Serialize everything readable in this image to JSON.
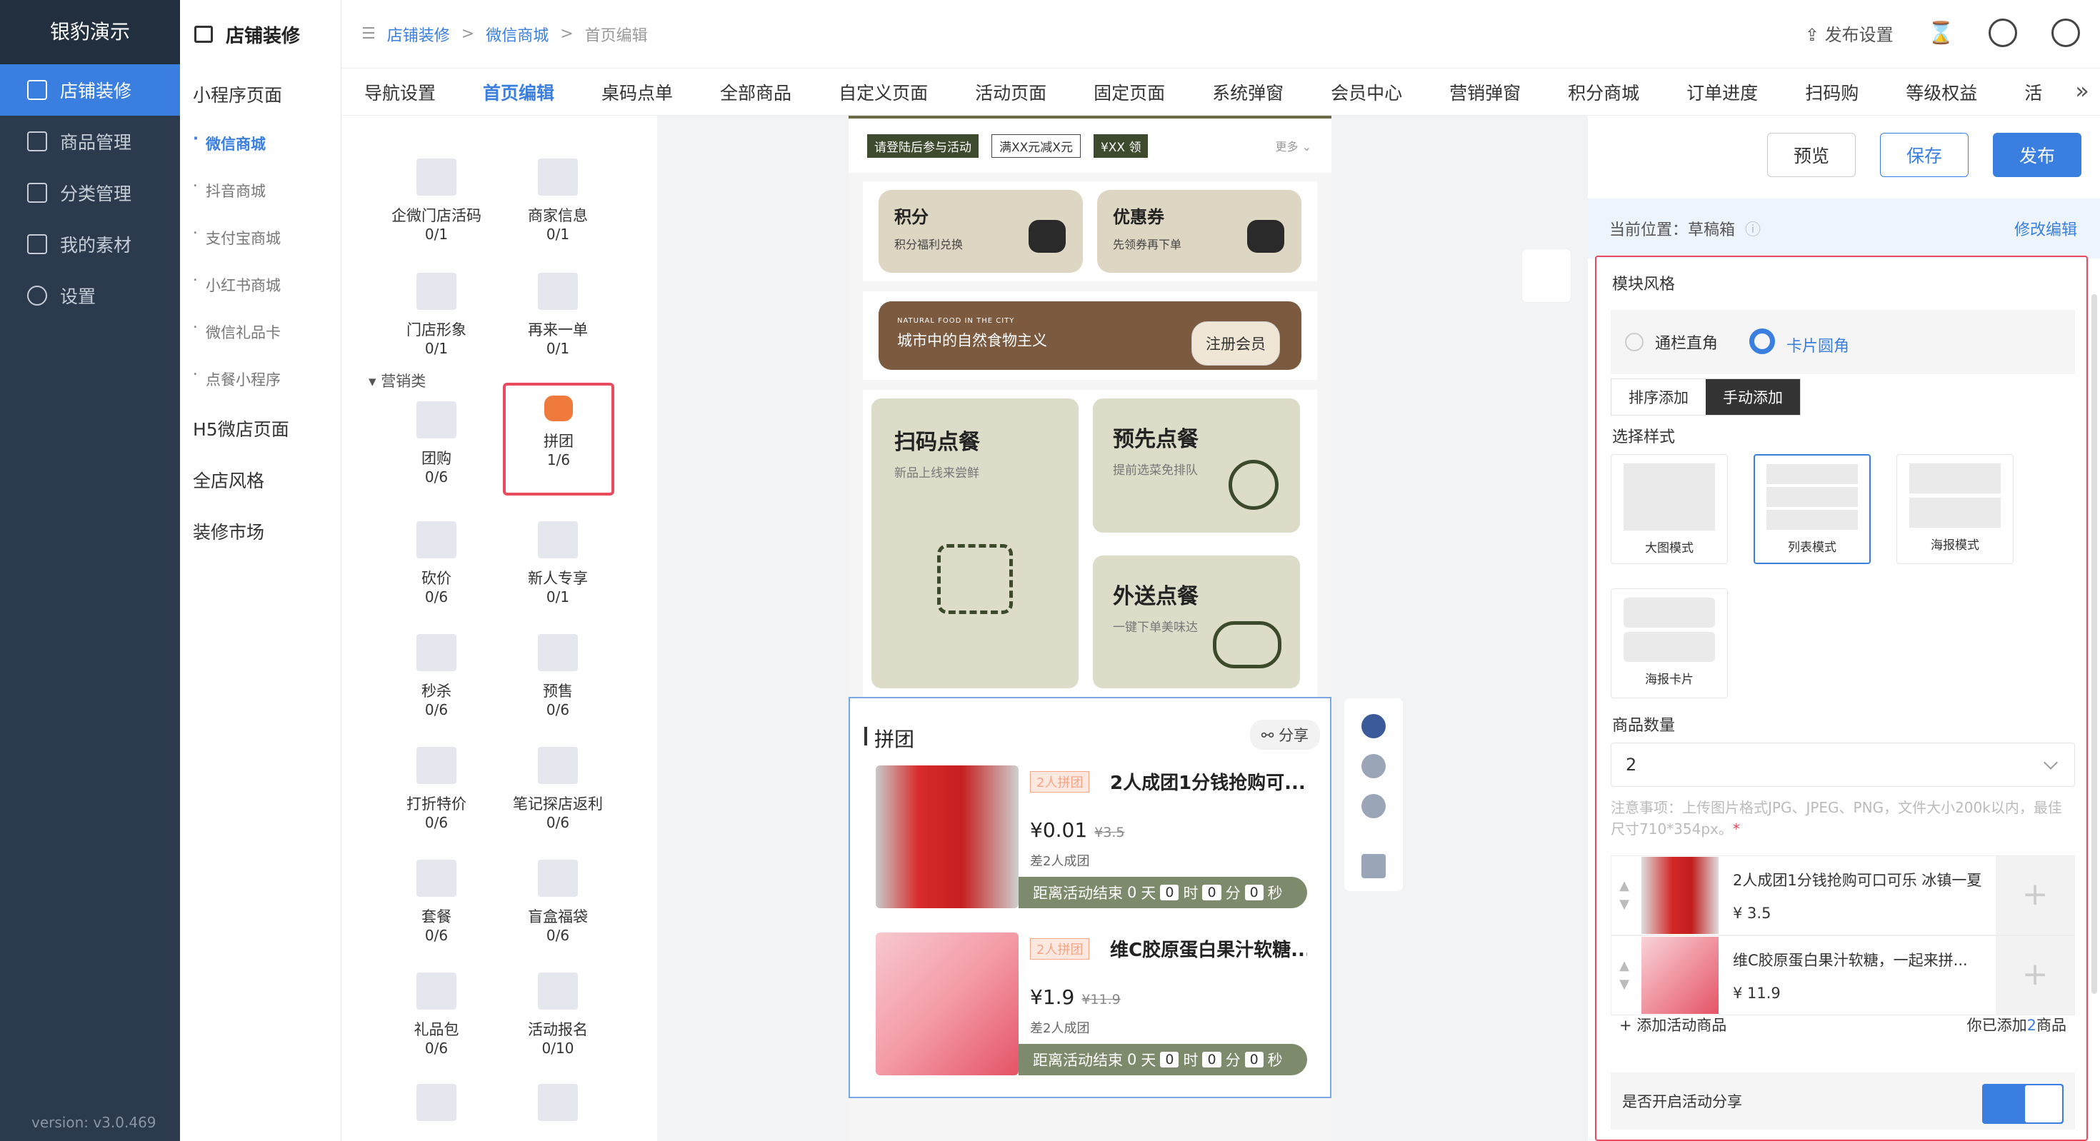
{
  "app": {
    "brand": "银豹演示",
    "version": "version: v3.0.469"
  },
  "nav1": [
    {
      "label": "店铺装修",
      "active": true
    },
    {
      "label": "商品管理"
    },
    {
      "label": "分类管理"
    },
    {
      "label": "我的素材"
    },
    {
      "label": "设置"
    }
  ],
  "nav2": {
    "title": "店铺装修",
    "group1": "小程序页面",
    "subs": [
      "微信商城",
      "抖音商城",
      "支付宝商城",
      "小红书商城",
      "微信礼品卡",
      "点餐小程序"
    ],
    "groups": [
      "H5微店页面",
      "全店风格",
      "装修市场"
    ]
  },
  "breadcrumb": {
    "a": "店铺装修",
    "sep": ">",
    "b": "微信商城",
    "c": "首页编辑"
  },
  "topbar": {
    "publish_settings": "发布设置"
  },
  "tabs": [
    "导航设置",
    "首页编辑",
    "桌码点单",
    "全部商品",
    "自定义页面",
    "活动页面",
    "固定页面",
    "系统弹窗",
    "会员中心",
    "营销弹窗",
    "积分商城",
    "订单进度",
    "扫码购",
    "等级权益",
    "活"
  ],
  "components": [
    {
      "name": "企微门店活码",
      "count": "0/1"
    },
    {
      "name": "商家信息",
      "count": "0/1"
    },
    {
      "name": "门店形象",
      "count": "0/1"
    },
    {
      "name": "再来一单",
      "count": "0/1"
    },
    {
      "name": "团购",
      "count": "0/6"
    },
    {
      "name": "拼团",
      "count": "1/6"
    },
    {
      "name": "砍价",
      "count": "0/6"
    },
    {
      "name": "新人专享",
      "count": "0/1"
    },
    {
      "name": "秒杀",
      "count": "0/6"
    },
    {
      "name": "预售",
      "count": "0/6"
    },
    {
      "name": "打折特价",
      "count": "0/6"
    },
    {
      "name": "笔记探店返利",
      "count": "0/6"
    },
    {
      "name": "套餐",
      "count": "0/6"
    },
    {
      "name": "盲盒福袋",
      "count": "0/6"
    },
    {
      "name": "礼品包",
      "count": "0/6"
    },
    {
      "name": "活动报名",
      "count": "0/10"
    }
  ],
  "category": "营销类",
  "preview": {
    "coupon": {
      "t1": "请登陆后参与活动",
      "t2": "满XX元减X元",
      "t3": "¥XX",
      "t4": "领",
      "more": "更多 ⌄"
    },
    "card1": {
      "title": "积分",
      "sub": "积分福利兑换"
    },
    "card2": {
      "title": "优惠券",
      "sub": "先领券再下单"
    },
    "banner": {
      "en": "NATURAL FOOD IN THE CITY",
      "cn": "城市中的自然食物主义",
      "btn": "注册会员"
    },
    "food": [
      {
        "title": "扫码点餐",
        "sub": "新品上线来尝鲜"
      },
      {
        "title": "预先点餐",
        "sub": "提前选菜免排队"
      },
      {
        "title": "外送点餐",
        "sub": "一键下单美味达"
      }
    ],
    "group": {
      "title": "拼团",
      "share": "分享",
      "products": [
        {
          "badge": "2人拼团",
          "name": "2人成团1分钱抢购可...",
          "price": "¥0.01",
          "orig": "¥3.5",
          "diff": "差2人成团",
          "cd": [
            "距离活动结束",
            "0",
            "天",
            "0",
            "时",
            "0",
            "分",
            "0",
            "秒"
          ]
        },
        {
          "badge": "2人拼团",
          "name": "维C胶原蛋白果汁软糖...",
          "price": "¥1.9",
          "orig": "¥11.9",
          "diff": "差2人成团",
          "cd": [
            "距离活动结束",
            "0",
            "天",
            "0",
            "时",
            "0",
            "分",
            "0",
            "秒"
          ]
        }
      ]
    }
  },
  "panel": {
    "preview": "预览",
    "save": "保存",
    "publish": "发布",
    "location": "当前位置：草稿箱",
    "edit": "修改编辑",
    "module_style": "模块风格",
    "r1": "通栏直角",
    "r2": "卡片圆角",
    "seg1": "排序添加",
    "seg2": "手动添加",
    "choose": "选择样式",
    "styles": [
      "大图模式",
      "列表模式",
      "海报模式",
      "海报卡片"
    ],
    "qty_label": "商品数量",
    "qty": "2",
    "note": "注意事项：上传图片格式JPG、JPEG、PNG，文件大小200k以内，最佳尺寸710*354px。",
    "items": [
      {
        "name": "2人成团1分钱抢购可口可乐 冰镇一夏",
        "price": "¥ 3.5"
      },
      {
        "name": "维C胶原蛋白果汁软糖，一起来拼...",
        "price": "¥ 11.9"
      }
    ],
    "add": "+ 添加活动商品",
    "added_pre": "你已添加",
    "added_n": "2",
    "added_suf": "商品",
    "share": "是否开启活动分享"
  }
}
